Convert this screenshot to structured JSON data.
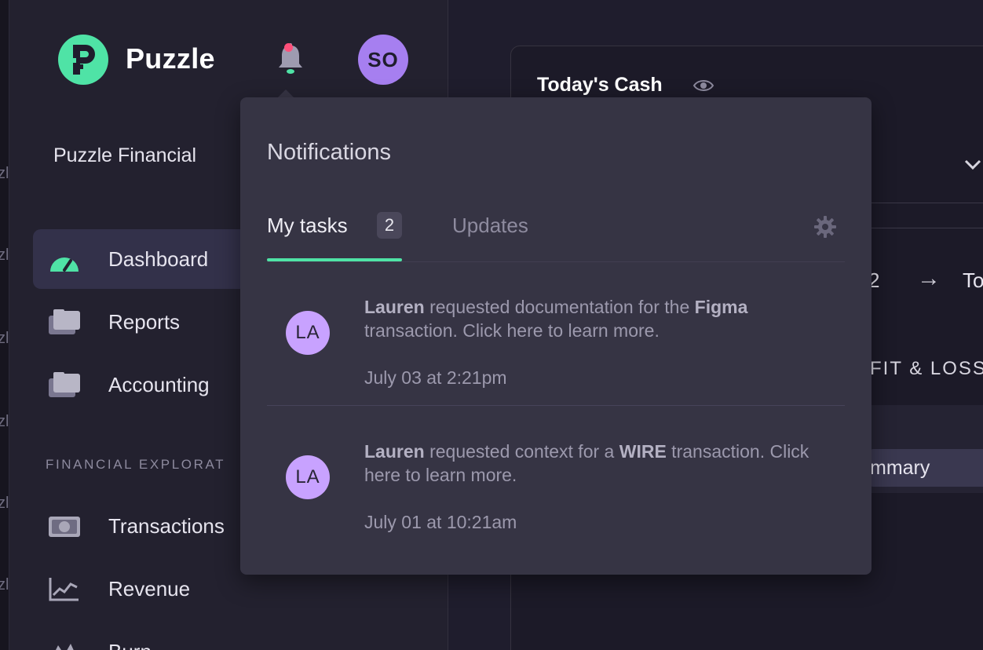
{
  "app": {
    "brand": "Puzzle",
    "org_name": "Puzzle Financial",
    "user_initials": "SO"
  },
  "sidebar": {
    "items": [
      {
        "label": "Dashboard",
        "icon": "gauge-icon",
        "active": true
      },
      {
        "label": "Reports",
        "icon": "folder-icon"
      },
      {
        "label": "Accounting",
        "icon": "folder-icon"
      }
    ],
    "section_header": "FINANCIAL EXPLORAT",
    "explore_items": [
      {
        "label": "Transactions",
        "icon": "cash-icon"
      },
      {
        "label": "Revenue",
        "icon": "chart-line-icon"
      },
      {
        "label": "Burn",
        "icon": "mountain-icon"
      }
    ]
  },
  "main": {
    "cash_title": "Today's Cash",
    "frag_number": "2",
    "frag_arrow": "→",
    "frag_to": "To",
    "frag_pl": "FIT & LOSS",
    "frag_summary": "mmary"
  },
  "left_strip": [
    "zl",
    "zl",
    "zl",
    "zl",
    "zl",
    "zl",
    "zl"
  ],
  "notifications": {
    "title": "Notifications",
    "tabs": [
      {
        "label": "My tasks",
        "count": "2",
        "active": true
      },
      {
        "label": "Updates",
        "active": false
      }
    ],
    "items": [
      {
        "initials": "LA",
        "actor": "Lauren",
        "text_a": " requested documentation for the ",
        "subject": "Figma",
        "text_b": " transaction.  Click here to learn more.",
        "time": "July 03 at 2:21pm"
      },
      {
        "initials": "LA",
        "actor": "Lauren",
        "text_a": " requested context for a ",
        "subject": "WIRE",
        "text_b": " transaction. Click here to learn more.",
        "time": "July 01 at 10:21am"
      }
    ]
  },
  "colors": {
    "accent": "#4fe3a6",
    "avatar_user": "#a67ff0",
    "avatar_notif": "#c8a2ff",
    "alert_dot": "#ff4f7a",
    "popover_bg": "#363444"
  }
}
